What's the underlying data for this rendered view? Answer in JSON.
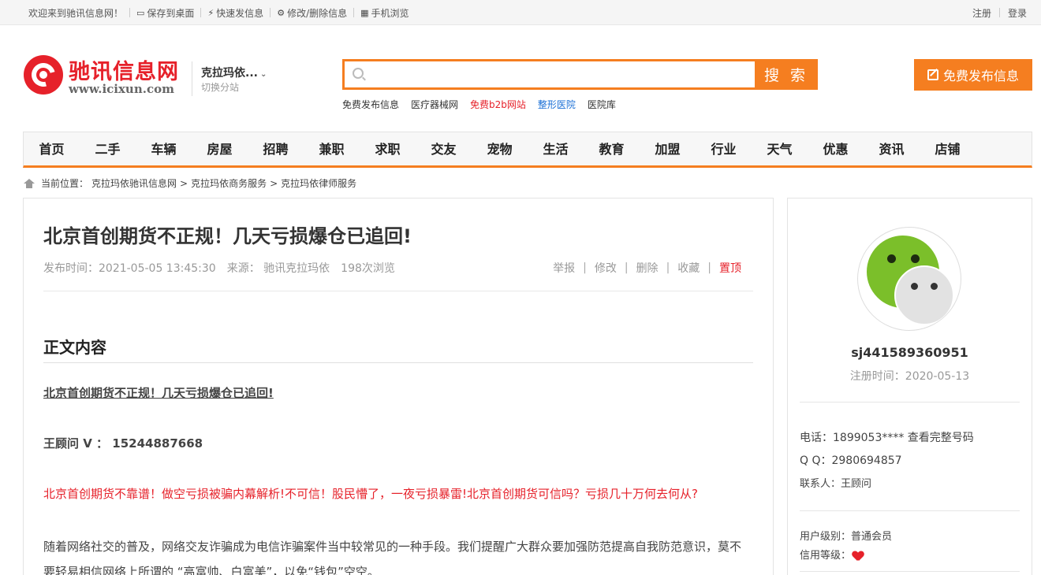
{
  "topbar": {
    "welcome": "欢迎来到驰讯信息网！",
    "save_desktop": "保存到桌面",
    "quick_post": "快速发信息",
    "edit_delete": "修改/删除信息",
    "mobile": "手机浏览",
    "register": "注册",
    "login": "登录"
  },
  "logo": {
    "name": "驰讯信息网",
    "url": "www.icixun.com"
  },
  "city": {
    "name": "克拉玛依...",
    "switch": "切换分站"
  },
  "search": {
    "value": "",
    "button": "搜 索",
    "hotlinks": [
      "免费发布信息",
      "医疗器械网",
      "免费b2b网站",
      "整形医院",
      "医院库"
    ]
  },
  "publish_button": "免费发布信息",
  "nav": [
    "首页",
    "二手",
    "车辆",
    "房屋",
    "招聘",
    "兼职",
    "求职",
    "交友",
    "宠物",
    "生活",
    "教育",
    "加盟",
    "行业",
    "天气",
    "优惠",
    "资讯",
    "店铺"
  ],
  "breadcrumb": {
    "prefix": "当前位置：",
    "items": [
      "克拉玛依驰讯信息网",
      "克拉玛依商务服务",
      "克拉玛依律师服务"
    ],
    "sep": ">"
  },
  "article": {
    "title": "北京首创期货不正规！几天亏损爆仓已追回!",
    "publish_time": "发布时间：2021-05-05 13:45:30",
    "source": "来源： 驰讯克拉玛依",
    "views": "198次浏览",
    "actions": [
      "举报",
      "修改",
      "删除",
      "收藏",
      "置顶"
    ],
    "section_heading": "正文内容",
    "link_title": "北京首创期货不正规！几天亏损爆仓已追回!",
    "contact_line": "王顾问 V ： 15244887668",
    "red_line": "北京首创期货不靠谱！做空亏损被骗内幕解析!不可信！股民懵了，一夜亏损暴雷!北京首创期货可信吗？亏损几十万何去何从?",
    "body": "随着网络社交的普及，网络交友诈骗成为电信诈骗案件当中较常见的一种手段。我们提醒广大群众要加强防范提高自我防范意识，莫不要轻易相信网络上所谓的 “高富帅、白富美”，以免“钱包”空空。"
  },
  "sidebar": {
    "avatar_icon": "wechat-icon",
    "username": "sj441589360951",
    "reg_time": "注册时间：2020-05-13",
    "phone": "电话：1899053**** 查看完整号码",
    "qq": "Q Q：2980694857",
    "contact": "联系人：王顾问",
    "user_level": "用户级别：普通会员",
    "credit_level": "信用等级："
  },
  "colors": {
    "accent": "#f57e20",
    "brand_red": "#e6212a",
    "link_blue": "#1a6fd6"
  }
}
